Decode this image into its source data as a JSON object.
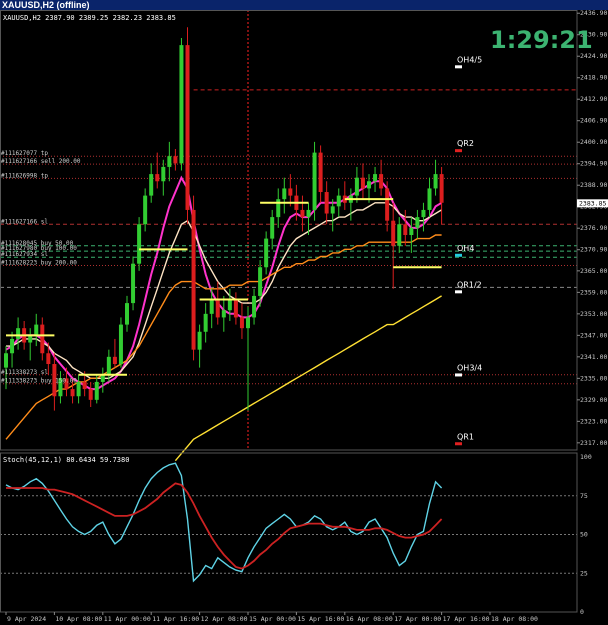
{
  "window": {
    "title": "XAUUSD,H2 (offline)"
  },
  "header": {
    "symbol_line": "XAUUSD,H2  2387.90 2389.25 2382.23 2383.85"
  },
  "stoch_header": "Stoch(45,12,1) 80.6434 59.7380",
  "countdown": "1:29:21",
  "current_price": "2383.85",
  "colors": {
    "bull": "#32cd32",
    "bear": "#dc1e1e",
    "ma_fast": "#ff33cc",
    "ma_white": "#ffe4c4",
    "ma_orange": "#ff8c1a",
    "ma_yellow": "#ffe033",
    "stoch_main": "#5fd3e6",
    "stoch_signal": "#cc2222",
    "level_line": "#ffff66"
  },
  "levels": [
    {
      "label": "OH4/5",
      "price": 2423.2,
      "marker": "#ffffff"
    },
    {
      "label": "QR2",
      "price": 2399.8,
      "marker": "#e02020"
    },
    {
      "label": "OH4",
      "price": 2370.6,
      "marker": "#22ccdd"
    },
    {
      "label": "QR1/2",
      "price": 2360.4,
      "marker": "#ffffff"
    },
    {
      "label": "OH3/4",
      "price": 2337.2,
      "marker": "#ffffff"
    },
    {
      "label": "QR1",
      "price": 2318.0,
      "marker": "#e02020"
    }
  ],
  "order_labels": [
    {
      "text": "#111627077 tp",
      "price": 2397.0
    },
    {
      "text": "#111627166 sell 200.00",
      "price": 2394.8
    },
    {
      "text": "#111626998 tp",
      "price": 2390.8
    },
    {
      "text": "#111627166 sl",
      "price": 2378.0
    },
    {
      "text": "#111628045 buy 50.00",
      "price": 2372.0
    },
    {
      "text": "#111627980 buy 100.00",
      "price": 2370.5
    },
    {
      "text": "#111627934 sl",
      "price": 2368.8
    },
    {
      "text": "#111628223 buy 200.00",
      "price": 2366.5
    },
    {
      "text": "#111338273 sl",
      "price": 2336.0
    },
    {
      "text": "#111338273 buy 150.00",
      "price": 2333.5
    }
  ],
  "chart_data": [
    {
      "type": "candlestick",
      "symbol": "XAUUSD",
      "timeframe": "H2",
      "ylim": [
        2315.0,
        2437.8
      ],
      "y_ticks": [
        2436.9,
        2430.9,
        2424.9,
        2418.9,
        2412.9,
        2406.9,
        2400.9,
        2394.9,
        2388.9,
        2382.9,
        2376.9,
        2370.9,
        2365.0,
        2359.0,
        2353.0,
        2347.0,
        2341.0,
        2335.0,
        2329.0,
        2323.0,
        2317.0
      ],
      "x_ticks": [
        "9 Apr 2024",
        "10 Apr 08:00",
        "11 Apr 00:00",
        "11 Apr 16:00",
        "12 Apr 08:00",
        "15 Apr 00:00",
        "15 Apr 16:00",
        "16 Apr 08:00",
        "17 Apr 00:00",
        "17 Apr 16:00",
        "18 Apr 08:00"
      ],
      "x_tick_index": [
        0,
        8,
        16,
        24,
        32,
        40,
        48,
        56,
        64,
        72,
        80
      ],
      "ohlc": [
        [
          2338,
          2344,
          2332,
          2342
        ],
        [
          2342,
          2348,
          2338,
          2346
        ],
        [
          2346,
          2352,
          2343,
          2349
        ],
        [
          2349,
          2351,
          2343,
          2345
        ],
        [
          2345,
          2349,
          2340,
          2347
        ],
        [
          2347,
          2353,
          2344,
          2350
        ],
        [
          2350,
          2352,
          2340,
          2342
        ],
        [
          2342,
          2345,
          2336,
          2339
        ],
        [
          2339,
          2342,
          2326,
          2330
        ],
        [
          2330,
          2337,
          2328,
          2335
        ],
        [
          2335,
          2338,
          2330,
          2332
        ],
        [
          2332,
          2335,
          2328,
          2330
        ],
        [
          2330,
          2336,
          2328,
          2334
        ],
        [
          2334,
          2337,
          2330,
          2332
        ],
        [
          2332,
          2334,
          2327,
          2329
        ],
        [
          2329,
          2336,
          2328,
          2334
        ],
        [
          2334,
          2338,
          2331,
          2336
        ],
        [
          2336,
          2343,
          2334,
          2341
        ],
        [
          2341,
          2346,
          2338,
          2339
        ],
        [
          2339,
          2352,
          2338,
          2350
        ],
        [
          2350,
          2358,
          2348,
          2356
        ],
        [
          2356,
          2369,
          2354,
          2367
        ],
        [
          2367,
          2380,
          2365,
          2378
        ],
        [
          2378,
          2388,
          2376,
          2386
        ],
        [
          2386,
          2395,
          2384,
          2392
        ],
        [
          2392,
          2398,
          2388,
          2390
        ],
        [
          2390,
          2396,
          2386,
          2394
        ],
        [
          2394,
          2401,
          2390,
          2397
        ],
        [
          2397,
          2399,
          2393,
          2395
        ],
        [
          2395,
          2430,
          2393,
          2428
        ],
        [
          2428,
          2433,
          2378,
          2382
        ],
        [
          2382,
          2386,
          2340,
          2343
        ],
        [
          2343,
          2350,
          2338,
          2348
        ],
        [
          2348,
          2356,
          2345,
          2353
        ],
        [
          2353,
          2360,
          2349,
          2357
        ],
        [
          2357,
          2362,
          2350,
          2352
        ],
        [
          2352,
          2358,
          2348,
          2354
        ],
        [
          2354,
          2360,
          2351,
          2357
        ],
        [
          2357,
          2359,
          2350,
          2352
        ],
        [
          2352,
          2356,
          2346,
          2349
        ],
        [
          2349,
          2355,
          2326,
          2352
        ],
        [
          2352,
          2360,
          2350,
          2358
        ],
        [
          2358,
          2368,
          2355,
          2366
        ],
        [
          2366,
          2376,
          2364,
          2374
        ],
        [
          2374,
          2382,
          2371,
          2380
        ],
        [
          2380,
          2388,
          2377,
          2385
        ],
        [
          2385,
          2391,
          2381,
          2388
        ],
        [
          2388,
          2392,
          2383,
          2386
        ],
        [
          2386,
          2389,
          2379,
          2382
        ],
        [
          2382,
          2386,
          2376,
          2380
        ],
        [
          2380,
          2384,
          2375,
          2382
        ],
        [
          2382,
          2401,
          2379,
          2398
        ],
        [
          2398,
          2400,
          2384,
          2387
        ],
        [
          2387,
          2390,
          2378,
          2381
        ],
        [
          2381,
          2385,
          2376,
          2383
        ],
        [
          2383,
          2388,
          2380,
          2386
        ],
        [
          2386,
          2390,
          2382,
          2384
        ],
        [
          2384,
          2388,
          2379,
          2386
        ],
        [
          2386,
          2394,
          2384,
          2391
        ],
        [
          2391,
          2395,
          2385,
          2388
        ],
        [
          2388,
          2392,
          2384,
          2390
        ],
        [
          2390,
          2394,
          2387,
          2392
        ],
        [
          2392,
          2396,
          2386,
          2388
        ],
        [
          2388,
          2390,
          2376,
          2379
        ],
        [
          2379,
          2384,
          2360,
          2372
        ],
        [
          2372,
          2380,
          2370,
          2378
        ],
        [
          2378,
          2382,
          2372,
          2375
        ],
        [
          2375,
          2380,
          2370,
          2377
        ],
        [
          2377,
          2382,
          2374,
          2380
        ],
        [
          2380,
          2384,
          2376,
          2382
        ],
        [
          2382,
          2391,
          2380,
          2388
        ],
        [
          2388,
          2396,
          2386,
          2392
        ],
        [
          2392,
          2394,
          2378,
          2384
        ]
      ],
      "ma": [
        {
          "name": "fast",
          "color": "#ff33cc",
          "values": [
            2343,
            2344,
            2346,
            2347,
            2347,
            2347,
            2346,
            2344,
            2341,
            2339,
            2337,
            2335,
            2334,
            2333,
            2332,
            2332,
            2333,
            2334,
            2335,
            2337,
            2340,
            2344,
            2350,
            2357,
            2364,
            2370,
            2377,
            2383,
            2387,
            2391,
            2388,
            2379,
            2371,
            2364,
            2359,
            2356,
            2354,
            2353,
            2353,
            2352,
            2352,
            2353,
            2356,
            2361,
            2366,
            2372,
            2377,
            2380,
            2381,
            2380,
            2380,
            2382,
            2384,
            2384,
            2384,
            2384,
            2385,
            2386,
            2387,
            2388,
            2389,
            2390,
            2390,
            2388,
            2384,
            2381,
            2379,
            2377,
            2377,
            2378,
            2380,
            2383,
            2384
          ]
        },
        {
          "name": "white",
          "color": "#ffe4c4",
          "values": [
            2344,
            2344,
            2345,
            2346,
            2346,
            2346,
            2345,
            2344,
            2342,
            2341,
            2340,
            2338,
            2337,
            2336,
            2335,
            2335,
            2335,
            2335,
            2336,
            2337,
            2339,
            2341,
            2345,
            2350,
            2355,
            2360,
            2365,
            2370,
            2374,
            2378,
            2379,
            2376,
            2372,
            2368,
            2365,
            2362,
            2360,
            2358,
            2357,
            2356,
            2356,
            2356,
            2357,
            2359,
            2362,
            2366,
            2369,
            2372,
            2374,
            2375,
            2376,
            2377,
            2378,
            2379,
            2379,
            2380,
            2380,
            2381,
            2382,
            2382,
            2383,
            2384,
            2384,
            2384,
            2383,
            2381,
            2380,
            2380,
            2379,
            2379,
            2380,
            2381,
            2382
          ]
        },
        {
          "name": "orange",
          "color": "#ff8c1a",
          "values": [
            2318,
            2320,
            2322,
            2324,
            2326,
            2328,
            2329,
            2330,
            2331,
            2332,
            2332,
            2333,
            2334,
            2334,
            2335,
            2335,
            2336,
            2337,
            2338,
            2339,
            2340,
            2342,
            2344,
            2347,
            2350,
            2353,
            2356,
            2359,
            2361,
            2362,
            2362,
            2362,
            2361,
            2360,
            2360,
            2360,
            2360,
            2361,
            2361,
            2361,
            2362,
            2362,
            2362,
            2363,
            2364,
            2365,
            2366,
            2366,
            2367,
            2367,
            2368,
            2368,
            2369,
            2369,
            2370,
            2370,
            2371,
            2371,
            2372,
            2372,
            2373,
            2373,
            2373,
            2373,
            2373,
            2373,
            2373,
            2373,
            2374,
            2374,
            2374,
            2375,
            2375
          ]
        },
        {
          "name": "yellow",
          "color": "#ffe033",
          "values": [
            null,
            null,
            null,
            null,
            null,
            null,
            null,
            null,
            null,
            null,
            null,
            null,
            null,
            null,
            null,
            null,
            null,
            null,
            null,
            null,
            null,
            null,
            null,
            null,
            null,
            null,
            null,
            null,
            2312,
            2314,
            2316,
            2318,
            2319,
            2320,
            2321,
            2322,
            2323,
            2324,
            2325,
            2326,
            2327,
            2328,
            2329,
            2330,
            2331,
            2332,
            2333,
            2334,
            2335,
            2336,
            2337,
            2338,
            2339,
            2340,
            2341,
            2342,
            2343,
            2344,
            2345,
            2346,
            2347,
            2348,
            2349,
            2350,
            2350,
            2351,
            2352,
            2353,
            2354,
            2355,
            2356,
            2357,
            2358
          ]
        }
      ],
      "horizontal_lines": [
        {
          "price": 2415.5,
          "color": "#cc2222",
          "style": "dash",
          "from": 32,
          "to": 96
        },
        {
          "price": 2397.0,
          "color": "#b03030",
          "style": "dot",
          "from": 0,
          "to": 96
        },
        {
          "price": 2394.8,
          "color": "#b03030",
          "style": "dot",
          "from": 0,
          "to": 96
        },
        {
          "price": 2390.8,
          "color": "#b03030",
          "style": "dot",
          "from": 0,
          "to": 96
        },
        {
          "price": 2378.0,
          "color": "#b03030",
          "style": "dash",
          "from": 0,
          "to": 96
        },
        {
          "price": 2372.0,
          "color": "#3cb371",
          "style": "dash",
          "from": 0,
          "to": 96
        },
        {
          "price": 2370.5,
          "color": "#3cb371",
          "style": "dash",
          "from": 0,
          "to": 96
        },
        {
          "price": 2368.8,
          "color": "#3cb371",
          "style": "dash",
          "from": 0,
          "to": 96
        },
        {
          "price": 2366.5,
          "color": "#b03030",
          "style": "dot",
          "from": 0,
          "to": 96
        },
        {
          "price": 2360.4,
          "color": "#888888",
          "style": "dash",
          "from": 0,
          "to": 96
        },
        {
          "price": 2336.0,
          "color": "#b03030",
          "style": "dot",
          "from": 0,
          "to": 96
        },
        {
          "price": 2333.5,
          "color": "#b03030",
          "style": "dot",
          "from": 0,
          "to": 96
        }
      ],
      "segments": [
        {
          "price": 2347,
          "from": 0,
          "to": 8
        },
        {
          "price": 2336,
          "from": 12,
          "to": 20
        },
        {
          "price": 2371,
          "from": 22,
          "to": 30
        },
        {
          "price": 2357,
          "from": 32,
          "to": 40
        },
        {
          "price": 2384,
          "from": 42,
          "to": 50
        },
        {
          "price": 2385,
          "from": 56,
          "to": 64
        },
        {
          "price": 2366,
          "from": 64,
          "to": 72
        }
      ],
      "vertical_lines": [
        {
          "index": 40,
          "color": "#ff2222"
        }
      ]
    },
    {
      "type": "line",
      "title": "Stoch(45,12,1) 80.6434 59.7380",
      "ylim": [
        0,
        100
      ],
      "y_ticks": [
        0,
        25,
        50,
        75,
        100
      ],
      "series": [
        {
          "name": "main",
          "color": "#5fd3e6",
          "values": [
            82,
            80,
            79,
            81,
            84,
            86,
            83,
            78,
            72,
            66,
            60,
            55,
            52,
            50,
            52,
            56,
            58,
            50,
            44,
            47,
            55,
            63,
            72,
            80,
            86,
            90,
            93,
            95,
            96,
            88,
            60,
            20,
            24,
            30,
            28,
            35,
            32,
            29,
            27,
            26,
            35,
            42,
            48,
            54,
            57,
            60,
            63,
            60,
            55,
            56,
            58,
            62,
            60,
            55,
            53,
            55,
            58,
            52,
            50,
            52,
            58,
            60,
            54,
            48,
            38,
            30,
            33,
            42,
            50,
            52,
            70,
            84,
            80
          ]
        },
        {
          "name": "signal",
          "color": "#cc2222",
          "values": [
            80,
            80,
            80,
            80,
            80,
            80,
            80,
            79,
            79,
            78,
            77,
            76,
            74,
            72,
            70,
            68,
            66,
            64,
            62,
            62,
            62,
            63,
            65,
            67,
            70,
            73,
            77,
            80,
            83,
            82,
            77,
            70,
            62,
            55,
            48,
            42,
            37,
            33,
            29,
            28,
            30,
            33,
            37,
            40,
            44,
            47,
            51,
            54,
            55,
            56,
            57,
            57,
            57,
            56,
            55,
            55,
            55,
            54,
            53,
            53,
            53,
            54,
            54,
            53,
            51,
            49,
            48,
            48,
            49,
            50,
            52,
            56,
            60
          ]
        }
      ]
    }
  ]
}
